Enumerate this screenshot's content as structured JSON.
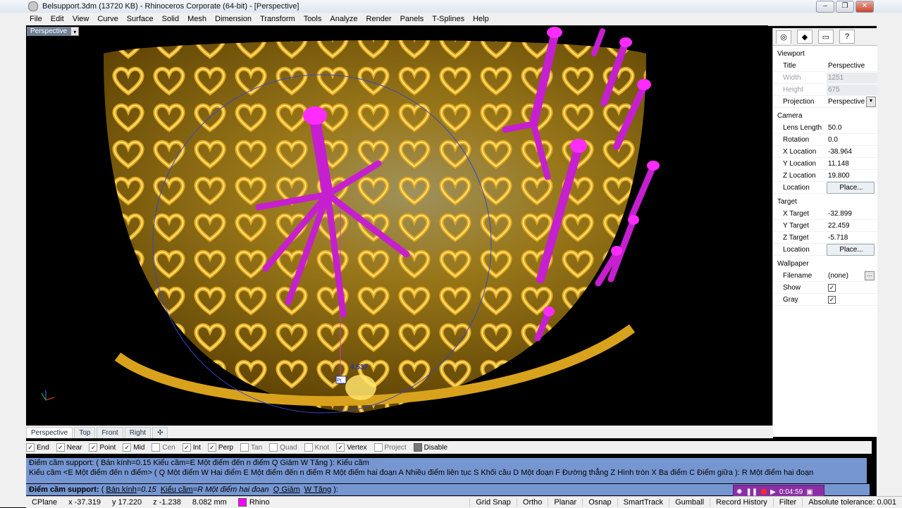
{
  "window": {
    "title": "Belsupport.3dm (13720 KB) - Rhinoceros Corporate (64-bit) - [Perspective]",
    "minimize": "–",
    "maximize": "❐",
    "close": "✕"
  },
  "menu": [
    "File",
    "Edit",
    "View",
    "Curve",
    "Surface",
    "Solid",
    "Mesh",
    "Dimension",
    "Transform",
    "Tools",
    "Analyze",
    "Render",
    "Panels",
    "T-Splines",
    "Help"
  ],
  "viewport": {
    "label": "Perspective",
    "dimension_text": "4.537",
    "point_label": "Pt",
    "colors": {
      "gold": "#f2c12e",
      "magenta": "#d81ddc",
      "circle": "#3646c8"
    }
  },
  "properties": {
    "sections": {
      "viewport": "Viewport",
      "camera": "Camera",
      "target": "Target",
      "wallpaper": "Wallpaper"
    },
    "viewport_rows": [
      {
        "label": "Title",
        "value": "Perspective"
      },
      {
        "label": "Width",
        "value": "1251"
      },
      {
        "label": "Height",
        "value": "675"
      },
      {
        "label": "Projection",
        "value": "Perspective"
      }
    ],
    "camera_rows": [
      {
        "label": "Lens Length",
        "value": "50.0"
      },
      {
        "label": "Rotation",
        "value": "0.0"
      },
      {
        "label": "X Location",
        "value": "-38.964"
      },
      {
        "label": "Y Location",
        "value": "11.148"
      },
      {
        "label": "Z Location",
        "value": "19.800"
      },
      {
        "label": "Location",
        "value": "Place..."
      }
    ],
    "target_rows": [
      {
        "label": "X Target",
        "value": "-32.899"
      },
      {
        "label": "Y Target",
        "value": "22.459"
      },
      {
        "label": "Z Target",
        "value": "-5.718"
      },
      {
        "label": "Location",
        "value": "Place..."
      }
    ],
    "wallpaper_rows": [
      {
        "label": "Filename",
        "value": "(none)"
      },
      {
        "label": "Show",
        "value": "✓"
      },
      {
        "label": "Gray",
        "value": "✓"
      }
    ]
  },
  "viewport_tabs": [
    "Perspective",
    "Top",
    "Front",
    "Right",
    "✣"
  ],
  "osnaps": [
    {
      "label": "End",
      "checked": true
    },
    {
      "label": "Near",
      "checked": true
    },
    {
      "label": "Point",
      "checked": true
    },
    {
      "label": "Mid",
      "checked": true
    },
    {
      "label": "Cen",
      "checked": false
    },
    {
      "label": "Int",
      "checked": true
    },
    {
      "label": "Perp",
      "checked": true
    },
    {
      "label": "Tan",
      "checked": false
    },
    {
      "label": "Quad",
      "checked": false
    },
    {
      "label": "Knot",
      "checked": false
    },
    {
      "label": "Vertex",
      "checked": true
    },
    {
      "label": "Project",
      "checked": false
    },
    {
      "label": "Disable",
      "checked": false
    }
  ],
  "command": {
    "history1": "Điểm cầm support: ( Bán kính=0.15  Kiểu cầm=E Một điểm đến n điểm  Q Giảm  W Tăng ): Kiểu cầm",
    "history2": "Kiểu cầm <E Một điểm đến n điểm> ( Q Một điểm  W Hai điểm  E Một điểm đến n điểm  R Một điểm hai đoạn  A Nhiều điểm liên tục  S Khối cầu  D Một đoạn  F Đường thẳng  Z Hình tròn  X Ba điểm  C Điểm giữa ): R Một điểm hai đoạn",
    "prompt_bold": "Điểm cầm support:",
    "prompt_rest_1": " ( ",
    "prompt_opt1_key": "Bán kính",
    "prompt_opt1_val": "=0.15",
    "prompt_opt2_key": "Kiểu cầm",
    "prompt_opt2_val": "=R Một điểm hai đoạn",
    "prompt_opt3": "Q Giảm",
    "prompt_opt4": "W Tăng",
    "prompt_end": " ):"
  },
  "recorder": {
    "time": "0:04:59"
  },
  "status": {
    "cplane": "CPlane",
    "x": "x -37.319",
    "y": "y 17.220",
    "z": "z -1.238",
    "units": "8.082 mm",
    "layer": "Rhino",
    "buttons": [
      "Grid Snap",
      "Ortho",
      "Planar",
      "Osnap",
      "SmartTrack",
      "Gumball",
      "Record History",
      "Filter"
    ],
    "tolerance": "Absolute tolerance: 0.001"
  }
}
